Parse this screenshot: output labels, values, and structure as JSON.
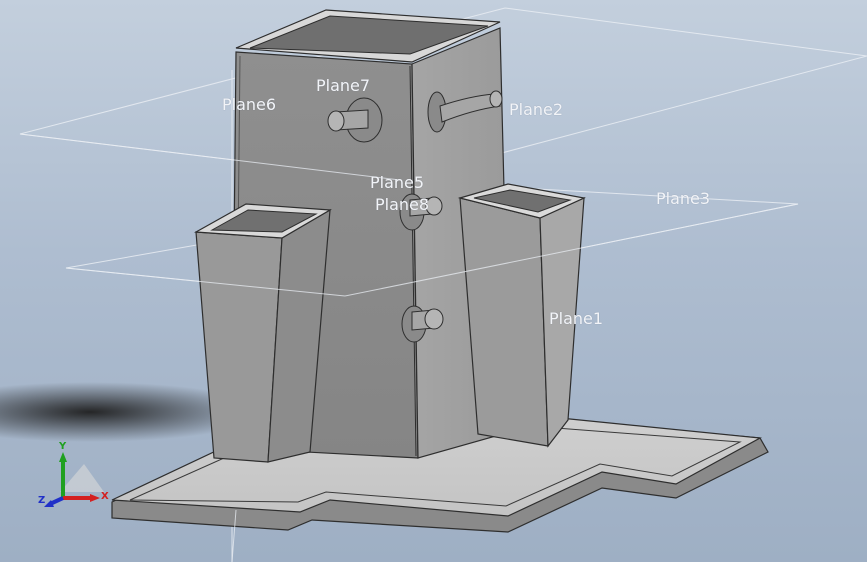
{
  "viewport": {
    "background_top": "#c3cfdd",
    "background_bottom": "#9eafc4"
  },
  "model": {
    "name": "",
    "color": "#9a9a9a"
  },
  "planes": [
    {
      "id": "plane1",
      "label": "Plane1"
    },
    {
      "id": "plane2",
      "label": "Plane2"
    },
    {
      "id": "plane3",
      "label": "Plane3"
    },
    {
      "id": "plane5",
      "label": "Plane5"
    },
    {
      "id": "plane6",
      "label": "Plane6"
    },
    {
      "id": "plane7",
      "label": "Plane7"
    },
    {
      "id": "plane8",
      "label": "Plane8"
    }
  ],
  "triad": {
    "x_label": "X",
    "y_label": "Y",
    "z_label": "Z",
    "x_color": "#d42020",
    "y_color": "#20a020",
    "z_color": "#2030c8"
  }
}
